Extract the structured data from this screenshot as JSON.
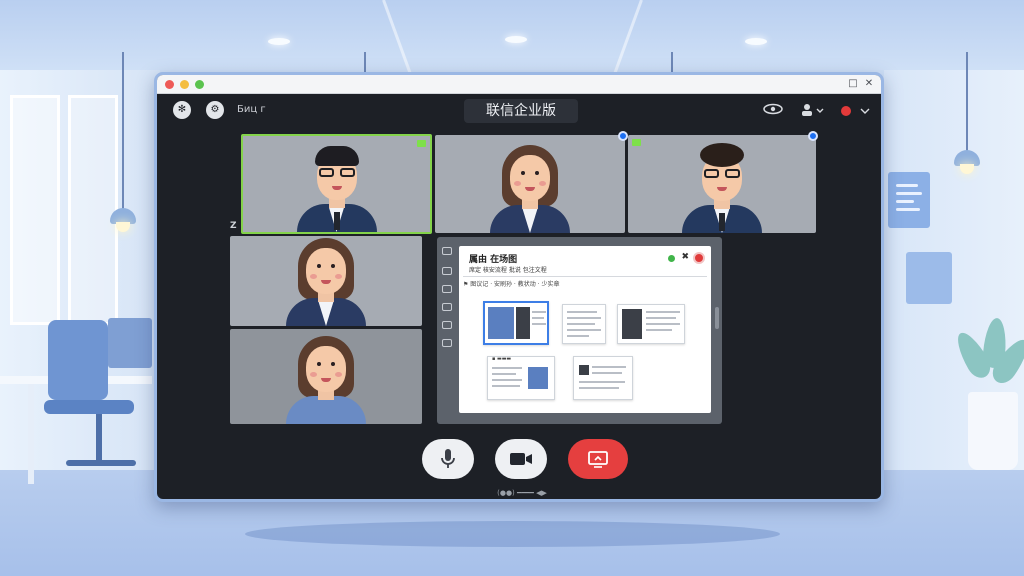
{
  "app": {
    "title": "联信企业版",
    "toolbar_label": "Биц г"
  },
  "window_controls": {
    "restore": "□",
    "close": "✕"
  },
  "toolbar_right": {
    "view_icon": "eye-icon",
    "people_icon": "people-icon",
    "record_icon": "record-icon",
    "chevron": "˅"
  },
  "participants": [
    {
      "id": "p1",
      "kind": "male-glasses",
      "active": true
    },
    {
      "id": "p2",
      "kind": "female",
      "pinned": true
    },
    {
      "id": "p3",
      "kind": "male-curly-glasses",
      "pinned": true
    },
    {
      "id": "p4",
      "kind": "female"
    },
    {
      "id": "p5",
      "kind": "female-casual"
    }
  ],
  "side_mark": "Z",
  "share": {
    "title": "属由 在场图",
    "subtitle": "席定 核安流程 批说  包注文程",
    "flag_text": "⚑ 图议记 · 安刷孙 · 教状动 · 少实章",
    "close_mark": "✖"
  },
  "controls": {
    "mic": "microphone-icon",
    "camera": "camera-icon",
    "share": "share-screen-icon",
    "caption": "(●●)  ━━━━  ◀▶"
  },
  "colors": {
    "active_border": "#84d34a",
    "pin": "#1d6ff2",
    "danger": "#e53f3f",
    "window_bg": "#1d2026"
  }
}
